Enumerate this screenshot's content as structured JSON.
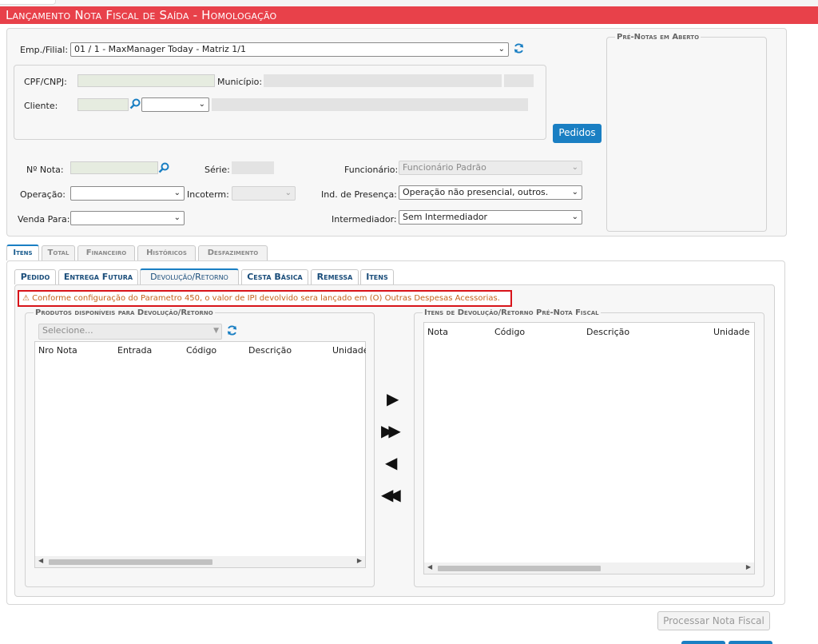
{
  "page": {
    "title": "Lançamento Nota Fiscal de Saída  - Homologação"
  },
  "header": {
    "emp_label": "Emp./Filial:",
    "emp_value": "01 / 1 - MaxManager Today - Matriz 1/1",
    "cpf_label": "CPF/CNPJ:",
    "municipio_label": "Município:",
    "cliente_label": "Cliente:",
    "pedidos_button": "Pedidos",
    "nota_label": "Nº Nota:",
    "serie_label": "Série:",
    "funcionario_label": "Funcionário:",
    "funcionario_value": "Funcionário Padrão",
    "operacao_label": "Operação:",
    "incoterm_label": "Incoterm:",
    "ind_presenca_label": "Ind. de Presença:",
    "ind_presenca_value": "Operação não presencial, outros.",
    "venda_para_label": "Venda Para:",
    "intermediador_label": "Intermediador:",
    "intermediador_value": "Sem Intermediador"
  },
  "pre_notas": {
    "legend": "Pré-Notas em Aberto"
  },
  "tabs_main": [
    "Itens",
    "Total",
    "Financeiro",
    "Históricos",
    "Desfazimento"
  ],
  "tabs_sub": [
    "Pedido",
    "Entrega Futura",
    "Devolução/Retorno",
    "Cesta Básica",
    "Remessa",
    "Itens"
  ],
  "warning": {
    "icon": "warning-icon",
    "text": "Conforme configuração do Parametro 450, o valor de IPI devolvido sera lançado em (O) Outras Despesas Acessorias."
  },
  "produtos": {
    "legend": "Produtos disponíveis para Devolução/Retorno",
    "select_placeholder": "Selecione...",
    "columns": [
      "Nro Nota",
      "Entrada",
      "Código",
      "Descrição",
      "Unidade"
    ]
  },
  "itens_dev": {
    "legend": "Itens de Devolução/Retorno Pré-Nota Fiscal",
    "columns": [
      "Nota",
      "Código",
      "Descrição",
      "Unidade"
    ]
  },
  "transfer": {
    "add_one": "▶",
    "add_all": "▶▶",
    "remove_one": "◀",
    "remove_all": "◀◀"
  },
  "footer": {
    "processar_button": "Processar Nota Fiscal"
  },
  "colors": {
    "title_bar": "#e8414a",
    "accent": "#1a7fc3",
    "warning_border": "#d8141a",
    "warning_text": "#c4621a"
  }
}
